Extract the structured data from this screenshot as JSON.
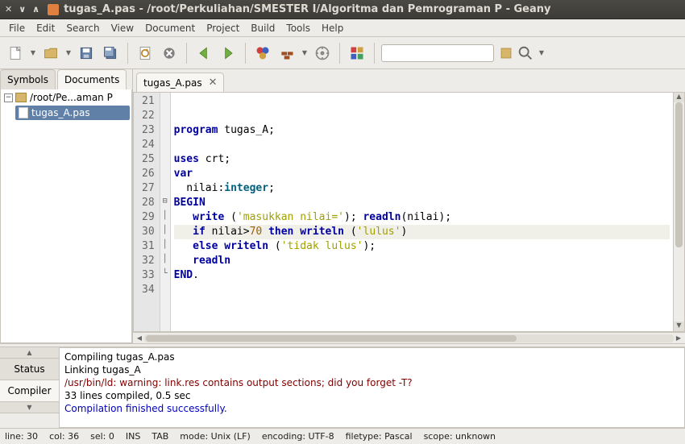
{
  "window": {
    "title": "tugas_A.pas - /root/Perkuliahan/SMESTER I/Algoritma dan Pemrograman P - Geany"
  },
  "menu": [
    "File",
    "Edit",
    "Search",
    "View",
    "Document",
    "Project",
    "Build",
    "Tools",
    "Help"
  ],
  "sidebar": {
    "tabs": [
      "Symbols",
      "Documents"
    ],
    "active_tab": 1,
    "folder": "/root/Pe...aman P",
    "file": "tugas_A.pas"
  },
  "editor": {
    "tab_label": "tugas_A.pas",
    "first_line": 21,
    "current_line": 30,
    "lines": [
      "",
      "",
      "program tugas_A;",
      "",
      "uses crt;",
      "var",
      "  nilai:integer;",
      "BEGIN",
      "   write ('masukkan nilai='); readln(nilai);",
      "   if nilai>70 then writeln ('lulus')",
      "   else writeln ('tidak lulus');",
      "   readln",
      "END.",
      ""
    ]
  },
  "compiler": {
    "tabs_up": "▲",
    "tabs_down": "▼",
    "tab_status": "Status",
    "tab_compiler": "Compiler",
    "messages": [
      {
        "text": "Compiling tugas_A.pas",
        "cls": ""
      },
      {
        "text": "Linking tugas_A",
        "cls": ""
      },
      {
        "text": "/usr/bin/ld: warning: link.res contains output sections; did you forget -T?",
        "cls": "msg-warn"
      },
      {
        "text": "33 lines compiled, 0.5 sec",
        "cls": ""
      },
      {
        "text": "Compilation finished successfully.",
        "cls": "msg-ok"
      }
    ]
  },
  "status": {
    "line": "line: 30",
    "col": "col: 36",
    "sel": "sel: 0",
    "ins": "INS",
    "tab": "TAB",
    "mode": "mode: Unix (LF)",
    "encoding": "encoding: UTF-8",
    "filetype": "filetype: Pascal",
    "scope": "scope: unknown"
  },
  "toolbar": {
    "search_placeholder": ""
  }
}
